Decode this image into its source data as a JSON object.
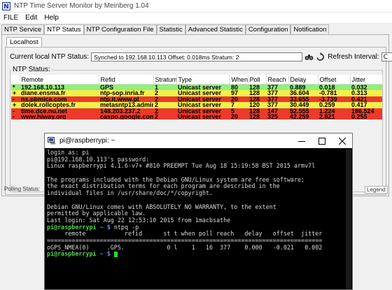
{
  "app": {
    "title": "NTP Time Server Monitor by Meinberg 1.04",
    "icon": "ntp-app-icon"
  },
  "menu": [
    "FILE",
    "Edit",
    "Help"
  ],
  "tabs": [
    {
      "label": "NTP Service",
      "active": false
    },
    {
      "label": "NTP Status",
      "active": true
    },
    {
      "label": "NTP Configuration File",
      "active": false
    },
    {
      "label": "Statistic",
      "active": false
    },
    {
      "label": "Advanced Statistic",
      "active": false
    },
    {
      "label": "Configuration",
      "active": false
    },
    {
      "label": "Notification",
      "active": false
    }
  ],
  "subtab": "Localhost",
  "status": {
    "label": "Current local NTP Status:",
    "value": "Synched to 192.168.10.113   Offset: 0.018ms   Stratum: 2",
    "refresh_label": "Refresh Interval:",
    "refresh_value": "C"
  },
  "group_title": "NTP Status:",
  "columns": [
    "",
    "Remote",
    "Refid",
    "Stratum",
    "Type",
    "When",
    "Poll",
    "Reach",
    "Delay",
    "Offset",
    "Jitter"
  ],
  "peers": [
    {
      "row_color": "green",
      "mark": "*",
      "remote": "192.168.10.113",
      "refid": "GPS",
      "stratum": "1",
      "type": "Unicast server",
      "when": "80",
      "poll": "128",
      "reach": "377",
      "delay": "0.889",
      "offset": "0.018",
      "jitter": "0.032"
    },
    {
      "row_color": "yellow",
      "mark": "+",
      "remote": "diane.ensma.fr",
      "refid": "ntp-sop.inria.fr",
      "stratum": "2",
      "type": "Unicast server",
      "when": "97",
      "poll": "128",
      "reach": "377",
      "delay": "36.604",
      "offset": "-0.781",
      "jitter": "0.313"
    },
    {
      "row_color": "red",
      "mark": "-",
      "remote": "ns.pbmica.com",
      "refid": "ntp.it.www.pl",
      "stratum": "2",
      "type": "Unicast server",
      "when": "20",
      "poll": "128",
      "reach": "377",
      "delay": "33.655",
      "offset": "-3.739",
      "jitter": "0.421"
    },
    {
      "row_color": "yellow",
      "mark": "+",
      "remote": "dolek.rollcoptes.fr",
      "refid": "metasntp13.admin.",
      "stratum": "2",
      "type": "Unicast server",
      "when": "7",
      "poll": "120",
      "reach": "377",
      "delay": "30.449",
      "offset": "0.259",
      "jitter": "0.417"
    },
    {
      "row_color": "red",
      "mark": "-",
      "remote": "time.dce.nu.net",
      "refid": "148.203.237.2",
      "stratum": "2",
      "type": "Unicast server",
      "when": "5",
      "poll": "128",
      "reach": "147",
      "delay": "52.555",
      "offset": "1.224",
      "jitter": "186.524"
    },
    {
      "row_color": "red",
      "mark": "-",
      "remote": "www.hiway.org",
      "refid": "caspo.google.com",
      "stratum": "2",
      "type": "Unicast server",
      "when": "20",
      "poll": "128",
      "reach": "325",
      "delay": "42.259",
      "offset": "2.821",
      "jitter": "0.255"
    }
  ],
  "group_footer_left": "Polling Status:",
  "group_footer_right": "Legend",
  "putty": {
    "title": "pi@raspberrypi: ~",
    "lines": [
      [
        {
          "t": "login as: pi",
          "c": "t-white"
        }
      ],
      [
        {
          "t": "pi@192.168.10.113's password:",
          "c": "t-white"
        }
      ],
      [
        {
          "t": "Linux raspberrypi 4.1.6-v7+ #810 PREEMPT Tue Aug 18 15:19:58 BST 2015 armv7l",
          "c": "t-white"
        }
      ],
      [
        {
          "t": "",
          "c": "t-white"
        }
      ],
      [
        {
          "t": "The programs included with the Debian GNU/Linux system are free software;",
          "c": "t-white"
        }
      ],
      [
        {
          "t": "the exact distribution terms for each program are described in the",
          "c": "t-white"
        }
      ],
      [
        {
          "t": "individual files in /usr/share/doc/*/copyright.",
          "c": "t-white"
        }
      ],
      [
        {
          "t": "",
          "c": "t-white"
        }
      ],
      [
        {
          "t": "Debian GNU/Linux comes with ABSOLUTELY NO WARRANTY, to the extent",
          "c": "t-white"
        }
      ],
      [
        {
          "t": "permitted by applicable law.",
          "c": "t-white"
        }
      ],
      [
        {
          "t": "Last login: Sat Aug 22 12:53:10 2015 from 1macbsathe",
          "c": "t-white"
        }
      ],
      [
        {
          "t": "pi@raspberrypi",
          "c": "t-green"
        },
        {
          "t": " ~ $ ",
          "c": "t-blue"
        },
        {
          "t": "ntpq -p",
          "c": "t-white"
        }
      ],
      [
        {
          "t": "     remote           refid      st t when poll reach   delay   offset  jitter",
          "c": "t-white"
        }
      ],
      [
        {
          "t": "==============================================================================",
          "c": "t-white"
        }
      ],
      [
        {
          "t": "oGPS_NMEA(0)     .GPS.            0 l    1   16  377    0.000   -0.021   0.002",
          "c": "t-white"
        }
      ],
      [
        {
          "t": "pi@raspberrypi",
          "c": "t-green"
        },
        {
          "t": " ~ $ ",
          "c": "t-blue"
        }
      ]
    ]
  }
}
